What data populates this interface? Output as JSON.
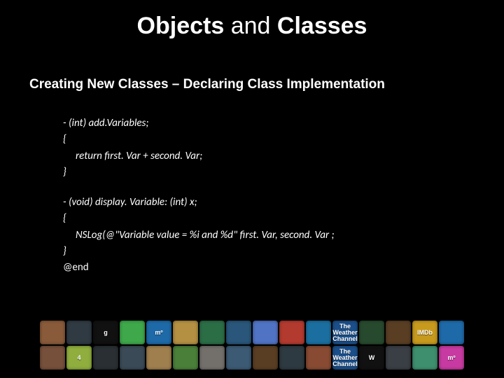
{
  "title": {
    "word1": "Objects",
    "word2": " and ",
    "word3": "Classes"
  },
  "subtitle": "Creating New Classes – Declaring Class Implementation",
  "code": {
    "l1": "- (int) add.Variables;",
    "l2": "{",
    "l3": "return first. Var + second. Var;",
    "l4": "}",
    "l5": "- (void) display. Variable: (int) x;",
    "l6": "{",
    "l7": "NSLog(@\"Variable value = %i and %d\" first. Var, second. Var ;",
    "l8": "}",
    "l9": "@end"
  },
  "dock": {
    "row1": [
      {
        "label": "",
        "bg": "#8a5b3a"
      },
      {
        "label": "",
        "bg": "#2f3a42"
      },
      {
        "label": "g",
        "bg": "#111111"
      },
      {
        "label": "",
        "bg": "#3ea84a"
      },
      {
        "label": "mº",
        "bg": "#1e6aa8"
      },
      {
        "label": "",
        "bg": "#b49042"
      },
      {
        "label": "",
        "bg": "#2b6e46"
      },
      {
        "label": "",
        "bg": "#29567a"
      },
      {
        "label": "",
        "bg": "#5173c4"
      },
      {
        "label": "",
        "bg": "#b33a2f"
      },
      {
        "label": "",
        "bg": "#1b6fa0"
      },
      {
        "label": "The\\nWeather\\nChannel",
        "bg": "#1b4f8a"
      },
      {
        "label": "",
        "bg": "#274a2e"
      },
      {
        "label": "",
        "bg": "#5a3e23"
      },
      {
        "label": "IMDb",
        "bg": "#c79a1e"
      },
      {
        "label": "",
        "bg": "#1e6aa8"
      }
    ],
    "row2": [
      {
        "label": "",
        "bg": "#77503b"
      },
      {
        "label": "4",
        "bg": "#8fae3e"
      },
      {
        "label": "",
        "bg": "#2a2f33"
      },
      {
        "label": "",
        "bg": "#3a4a56"
      },
      {
        "label": "",
        "bg": "#a07f4e"
      },
      {
        "label": "",
        "bg": "#4a7f3a"
      },
      {
        "label": "",
        "bg": "#73706c"
      },
      {
        "label": "",
        "bg": "#3c5a74"
      },
      {
        "label": "",
        "bg": "#5a3e23"
      },
      {
        "label": "",
        "bg": "#2e3a41"
      },
      {
        "label": "",
        "bg": "#884a32"
      },
      {
        "label": "The\\nWeather\\nChannel",
        "bg": "#1b4f8a"
      },
      {
        "label": "W",
        "bg": "#111111"
      },
      {
        "label": "",
        "bg": "#3a3f45"
      },
      {
        "label": "",
        "bg": "#3e8f6e"
      },
      {
        "label": "mº",
        "bg": "#c73aa1"
      }
    ]
  }
}
